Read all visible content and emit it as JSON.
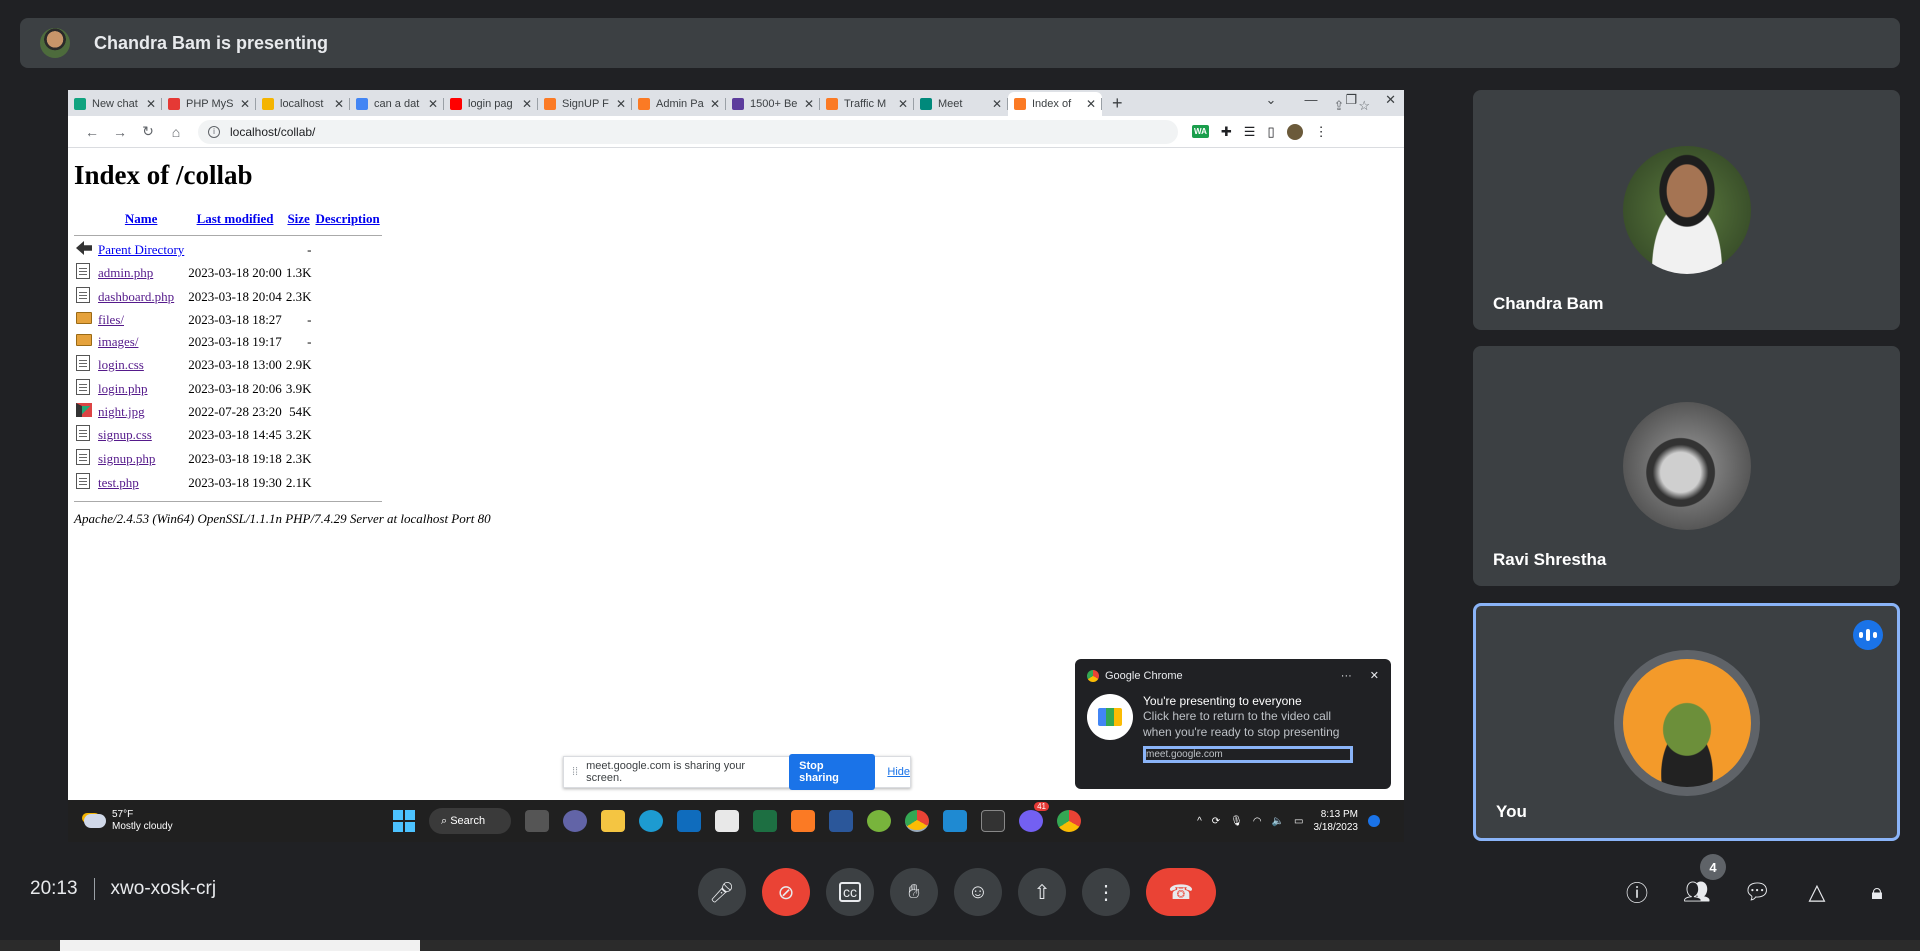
{
  "banner": {
    "text": "Chandra Bam is presenting"
  },
  "browser": {
    "tabs": [
      {
        "label": "New chat",
        "color": "#10a37f"
      },
      {
        "label": "PHP MyS",
        "color": "#e53935"
      },
      {
        "label": "localhost",
        "color": "#f4b400"
      },
      {
        "label": "can a dat",
        "color": "#4285f4"
      },
      {
        "label": "login pag",
        "color": "#ff0000"
      },
      {
        "label": "SignUP F",
        "color": "#fb7a24"
      },
      {
        "label": "Admin Pa",
        "color": "#fb7a24"
      },
      {
        "label": "1500+ Be",
        "color": "#5c3c9c"
      },
      {
        "label": "Traffic M",
        "color": "#fb7a24"
      },
      {
        "label": "Meet",
        "color": "#00897b"
      },
      {
        "label": "Index of",
        "color": "#fb7a24"
      }
    ],
    "url": "localhost/collab/",
    "ext_wa": "WA"
  },
  "page": {
    "title": "Index of /collab",
    "headers": {
      "name": "Name",
      "modified": "Last modified",
      "size": "Size",
      "desc": "Description"
    },
    "parent": {
      "name": "Parent Directory",
      "size": "-"
    },
    "rows": [
      {
        "name": "admin.php",
        "date": "2023-03-18 20:00",
        "size": "1.3K",
        "type": "file"
      },
      {
        "name": "dashboard.php",
        "date": "2023-03-18 20:04",
        "size": "2.3K",
        "type": "file"
      },
      {
        "name": "files/",
        "date": "2023-03-18 18:27",
        "size": "-",
        "type": "dir"
      },
      {
        "name": "images/",
        "date": "2023-03-18 19:17",
        "size": "-",
        "type": "dir"
      },
      {
        "name": "login.css",
        "date": "2023-03-18 13:00",
        "size": "2.9K",
        "type": "file"
      },
      {
        "name": "login.php",
        "date": "2023-03-18 20:06",
        "size": "3.9K",
        "type": "file"
      },
      {
        "name": "night.jpg",
        "date": "2022-07-28 23:20",
        "size": "54K",
        "type": "img"
      },
      {
        "name": "signup.css",
        "date": "2023-03-18 14:45",
        "size": "3.2K",
        "type": "file"
      },
      {
        "name": "signup.php",
        "date": "2023-03-18 19:18",
        "size": "2.3K",
        "type": "file"
      },
      {
        "name": "test.php",
        "date": "2023-03-18 19:30",
        "size": "2.1K",
        "type": "file"
      }
    ],
    "address": "Apache/2.4.53 (Win64) OpenSSL/1.1.1n PHP/7.4.29 Server at localhost Port 80"
  },
  "sharebar": {
    "text": "meet.google.com is sharing your screen.",
    "stop": "Stop sharing",
    "hide": "Hide"
  },
  "toast": {
    "app": "Google Chrome",
    "title": "You're presenting to everyone",
    "body": "Click here to return to the video call when you're ready to stop presenting",
    "source": "meet.google.com"
  },
  "taskbar": {
    "temp": "57°F",
    "weather": "Mostly cloudy",
    "search": "Search",
    "time": "8:13 PM",
    "date": "3/18/2023",
    "badge": "41"
  },
  "participants": [
    {
      "name": "Chandra Bam"
    },
    {
      "name": "Ravi Shrestha"
    },
    {
      "name": "You"
    }
  ],
  "meeting": {
    "time": "20:13",
    "code": "xwo-xosk-crj",
    "people_count": "4"
  }
}
